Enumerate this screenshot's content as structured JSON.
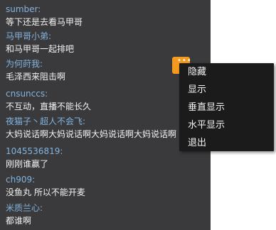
{
  "messages": [
    {
      "name": "sumber:",
      "text": "等下还是去看马甲哥"
    },
    {
      "name": "马甲哥小弟:",
      "text": "和马甲哥一起排吧"
    },
    {
      "name": "为何莳我:",
      "text": "毛泽西来阻击啊"
    },
    {
      "name": "cnsunccs:",
      "text": "不互动，直播不能长久"
    },
    {
      "name": "夜猫子丶超人不会飞:",
      "text": "大妈说话啊大妈说话啊大妈说话啊大妈说话啊"
    },
    {
      "name": "1045536819:",
      "text": "刚刚谁赢了"
    },
    {
      "name": "ch909:",
      "text": "没鱼丸 所以不能开麦"
    },
    {
      "name": "米质兰心:",
      "text": "都谁啊"
    }
  ],
  "float_button": {
    "icon": "more-dots-icon",
    "color": "#f49a1e"
  },
  "context_menu": {
    "items": [
      "隐藏",
      "显示",
      "垂直显示",
      "水平显示",
      "退出"
    ]
  },
  "colors": {
    "panel_bg": "#3a3a3c",
    "name_color": "#82b4e0",
    "text_color": "#f2f2f2",
    "menu_bg": "#1b1b1c"
  }
}
